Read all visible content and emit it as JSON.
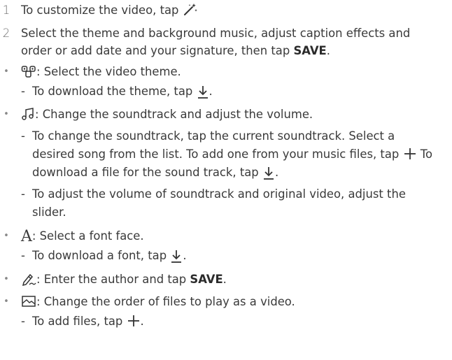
{
  "steps": [
    {
      "number": "1",
      "text": "To customize the video, tap"
    },
    {
      "number": "2",
      "line1": "Select the theme and background music, adjust caption effects and",
      "line2_pre": "order or add date and your signature, then tap ",
      "line2_bold": "SAVE",
      "line2_post": "."
    }
  ],
  "items": {
    "theme": {
      "text": ": Select the video theme.",
      "sub1": "To download the theme, tap"
    },
    "music": {
      "text": ": Change the soundtrack and adjust the volume.",
      "sub1_l1": "To change the soundtrack, tap the current soundtrack. Select a",
      "sub1_l2": "desired song from the list. To add one from your music files, tap",
      "sub1_l2b": " To",
      "sub1_l3": "download a file for the sound track, tap",
      "sub2_l1": "To adjust the volume of soundtrack and original video, adjust the",
      "sub2_l2": "slider."
    },
    "font": {
      "glyph": "A",
      "text": ": Select a font face.",
      "sub1": "To download a font, tap"
    },
    "author": {
      "text_pre": ": Enter the author and tap ",
      "text_bold": "SAVE",
      "text_post": "."
    },
    "order": {
      "text": ": Change the order of files to play as a video.",
      "sub1": "To add files, tap"
    }
  },
  "punct": {
    "period": ".",
    "dash": "-",
    "bullet": "•"
  },
  "colors": {
    "text": "#3a3a3a",
    "icon": "#333333"
  },
  "icons": [
    "magic-wand-icon",
    "theme-icon",
    "music-note-icon",
    "download-icon",
    "plus-icon",
    "font-icon",
    "pen-icon",
    "image-order-icon"
  ]
}
